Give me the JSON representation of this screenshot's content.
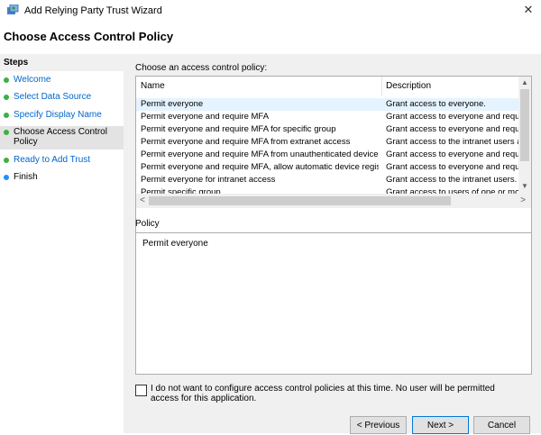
{
  "window": {
    "title": "Add Relying Party Trust Wizard",
    "close_glyph": "✕",
    "icon": "wizard-app-icon"
  },
  "heading": "Choose Access Control Policy",
  "steps": {
    "title": "Steps",
    "items": [
      {
        "label": "Welcome",
        "status": "completed",
        "color": "#3cb043"
      },
      {
        "label": "Select Data Source",
        "status": "completed",
        "color": "#3cb043"
      },
      {
        "label": "Specify Display Name",
        "status": "completed",
        "color": "#3cb043"
      },
      {
        "label": "Choose Access Control Policy",
        "status": "current",
        "color": "#3cb043"
      },
      {
        "label": "Ready to Add Trust",
        "status": "pending",
        "color": "#3cb043"
      },
      {
        "label": "Finish",
        "status": "pending",
        "color": "#1e90ff"
      }
    ]
  },
  "policy_list": {
    "label": "Choose an access control policy:",
    "columns": [
      "Name",
      "Description"
    ],
    "rows": [
      {
        "name": "Permit everyone",
        "description": "Grant access to everyone.",
        "selected": true
      },
      {
        "name": "Permit everyone and require MFA",
        "description": "Grant access to everyone and requir"
      },
      {
        "name": "Permit everyone and require MFA for specific group",
        "description": "Grant access to everyone and requir"
      },
      {
        "name": "Permit everyone and require MFA from extranet access",
        "description": "Grant access to the intranet users an"
      },
      {
        "name": "Permit everyone and require MFA from unauthenticated devices",
        "description": "Grant access to everyone and requir"
      },
      {
        "name": "Permit everyone and require MFA, allow automatic device registr...",
        "description": "Grant access to everyone and requir"
      },
      {
        "name": "Permit everyone for intranet access",
        "description": "Grant access to the intranet users."
      },
      {
        "name": "Permit specific group",
        "description": "Grant access to users of one or more"
      }
    ],
    "scroll_arrows": {
      "up": "▲",
      "down": "▼",
      "left": "<",
      "right": ">"
    }
  },
  "policy": {
    "label": "Policy",
    "text": "Permit everyone"
  },
  "skip_checkbox": {
    "checked": false,
    "label": "I do not want to configure access control policies at this time. No user will be permitted access for this application."
  },
  "buttons": {
    "previous": "< Previous",
    "next": "Next >",
    "cancel": "Cancel"
  },
  "colors": {
    "selection": "#e5f3ff",
    "step_active_bg": "#e3e3e3",
    "link_blue": "#0066cc",
    "panel_bg": "#f0f0f0"
  }
}
